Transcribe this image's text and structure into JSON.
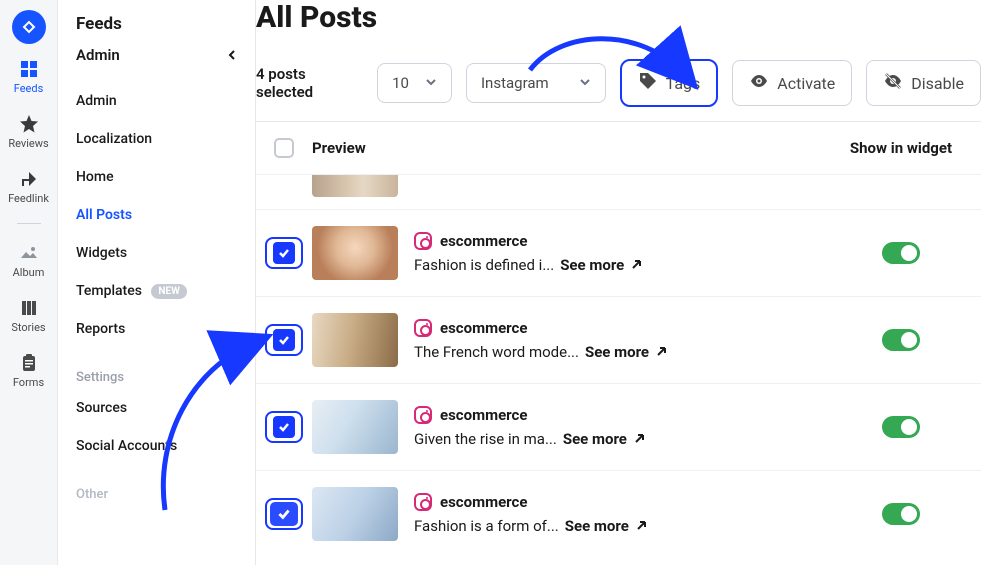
{
  "rail": {
    "items": [
      {
        "label": "Feeds",
        "active": true
      },
      {
        "label": "Reviews"
      },
      {
        "label": "Feedlink"
      },
      {
        "label": "Album"
      },
      {
        "label": "Stories"
      },
      {
        "label": "Forms"
      }
    ]
  },
  "sidebar": {
    "title": "Feeds",
    "admin_label": "Admin",
    "links": [
      {
        "label": "Admin"
      },
      {
        "label": "Localization"
      },
      {
        "label": "Home"
      },
      {
        "label": "All Posts",
        "active": true
      },
      {
        "label": "Widgets"
      },
      {
        "label": "Templates",
        "badge": "NEW"
      },
      {
        "label": "Reports"
      }
    ],
    "settings_header": "Settings",
    "settings_links": [
      {
        "label": "Sources"
      },
      {
        "label": "Social Accounts"
      }
    ],
    "other_label": "Other"
  },
  "page": {
    "title": "All Posts",
    "selected_label": "4 posts selected",
    "page_size": "10",
    "source_filter": "Instagram",
    "actions": {
      "tags": "Tags",
      "activate": "Activate",
      "disable": "Disable"
    },
    "columns": {
      "preview": "Preview",
      "show": "Show in widget"
    },
    "see_more": "See more"
  },
  "posts": [
    {
      "username": "escommerce",
      "caption": "Fashion is defined i...",
      "checked": true,
      "enabled": true
    },
    {
      "username": "escommerce",
      "caption": "The French word mode...",
      "checked": true,
      "enabled": true
    },
    {
      "username": "escommerce",
      "caption": "Given the rise in ma...",
      "checked": true,
      "enabled": true
    },
    {
      "username": "escommerce",
      "caption": "Fashion is a form of...",
      "checked": true,
      "enabled": true
    }
  ]
}
